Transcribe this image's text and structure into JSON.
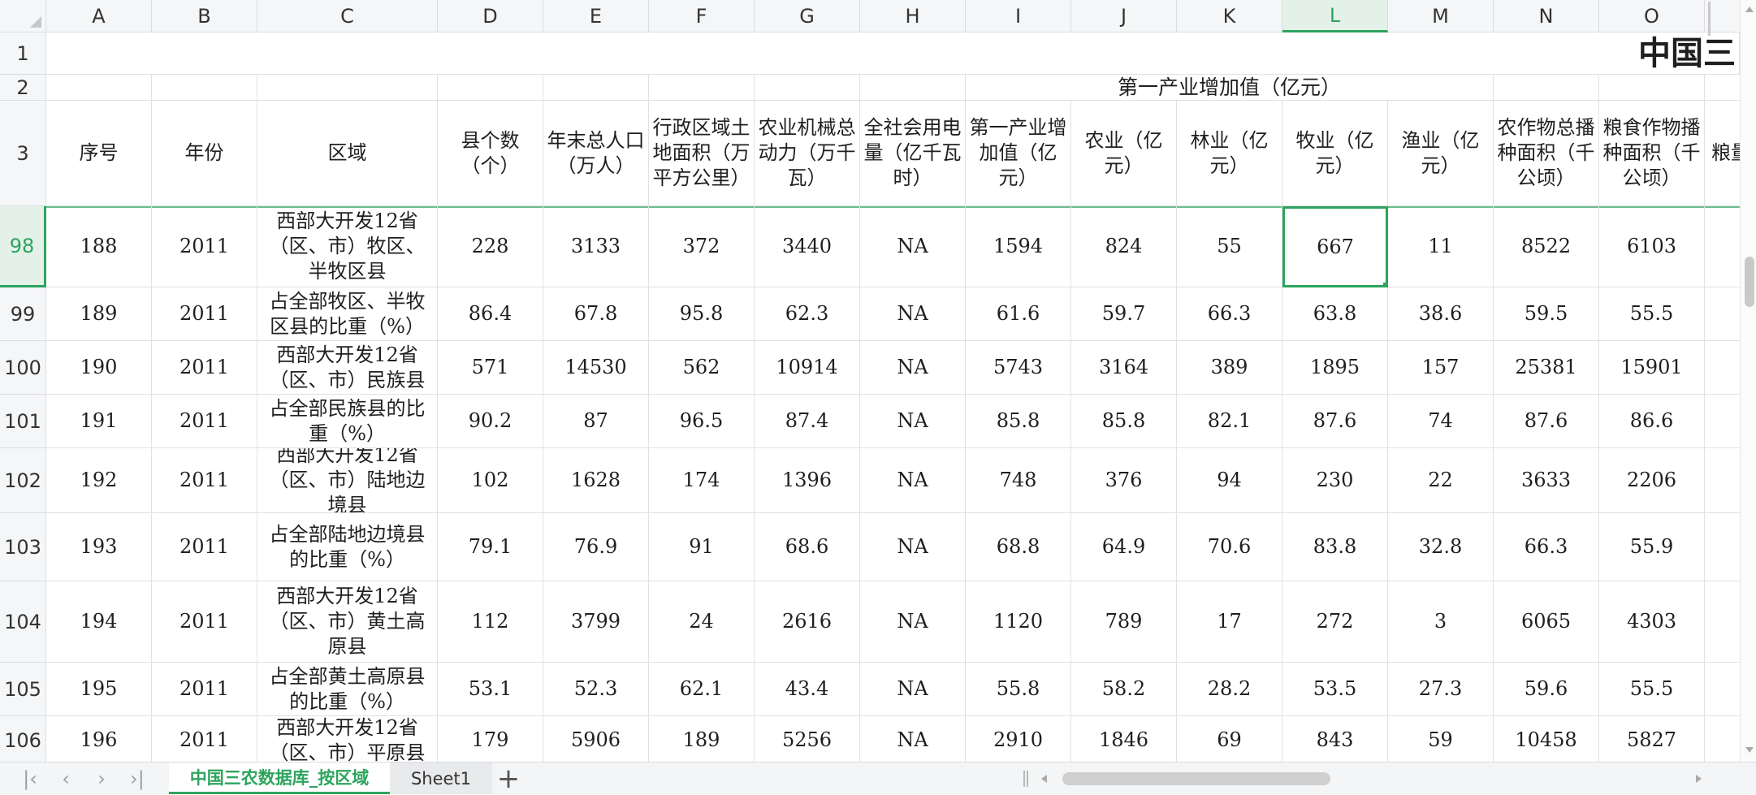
{
  "columns": [
    "A",
    "B",
    "C",
    "D",
    "E",
    "F",
    "G",
    "H",
    "I",
    "J",
    "K",
    "L",
    "M",
    "N",
    "O"
  ],
  "selected_column": "L",
  "selected_row": "98",
  "row1": {
    "row_number": "1",
    "title": "中国三"
  },
  "row2": {
    "row_number": "2",
    "group_header": "第一产业增加值（亿元）"
  },
  "row3": {
    "row_number": "3",
    "headers": [
      "序号",
      "年份",
      "区域",
      "县个数（个）",
      "年末总人口（万人）",
      "行政区域土地面积（万平方公里）",
      "农业机械总动力（万千瓦）",
      "全社会用电量（亿千瓦时）",
      "第一产业增加值（亿元）",
      "农业（亿元）",
      "林业（亿元）",
      "牧业（亿元）",
      "渔业（亿元）",
      "农作物总播种面积（千公顷）",
      "粮食作物播种面积（千公顷）",
      "粮量"
    ]
  },
  "rows": [
    {
      "row_number": "98",
      "cells": [
        "188",
        "2011",
        "西部大开发12省（区、市）牧区、半牧区县",
        "228",
        "3133",
        "372",
        "3440",
        "NA",
        "1594",
        "824",
        "55",
        "667",
        "11",
        "8522",
        "6103"
      ]
    },
    {
      "row_number": "99",
      "cells": [
        "189",
        "2011",
        "占全部牧区、半牧区县的比重（%）",
        "86.4",
        "67.8",
        "95.8",
        "62.3",
        "NA",
        "61.6",
        "59.7",
        "66.3",
        "63.8",
        "38.6",
        "59.5",
        "55.5"
      ]
    },
    {
      "row_number": "100",
      "cells": [
        "190",
        "2011",
        "西部大开发12省（区、市）民族县",
        "571",
        "14530",
        "562",
        "10914",
        "NA",
        "5743",
        "3164",
        "389",
        "1895",
        "157",
        "25381",
        "15901"
      ]
    },
    {
      "row_number": "101",
      "cells": [
        "191",
        "2011",
        "占全部民族县的比重（%）",
        "90.2",
        "87",
        "96.5",
        "87.4",
        "NA",
        "85.8",
        "85.8",
        "82.1",
        "87.6",
        "74",
        "87.6",
        "86.6"
      ]
    },
    {
      "row_number": "102",
      "cells": [
        "192",
        "2011",
        "西部大开发12省（区、市）陆地边境县",
        "102",
        "1628",
        "174",
        "1396",
        "NA",
        "748",
        "376",
        "94",
        "230",
        "22",
        "3633",
        "2206"
      ]
    },
    {
      "row_number": "103",
      "cells": [
        "193",
        "2011",
        "占全部陆地边境县的比重（%）",
        "79.1",
        "76.9",
        "91",
        "68.6",
        "NA",
        "68.8",
        "64.9",
        "70.6",
        "83.8",
        "32.8",
        "66.3",
        "55.9"
      ]
    },
    {
      "row_number": "104",
      "cells": [
        "194",
        "2011",
        "西部大开发12省（区、市）黄土高原县",
        "112",
        "3799",
        "24",
        "2616",
        "NA",
        "1120",
        "789",
        "17",
        "272",
        "3",
        "6065",
        "4303"
      ]
    },
    {
      "row_number": "105",
      "cells": [
        "195",
        "2011",
        "占全部黄土高原县的比重（%）",
        "53.1",
        "52.3",
        "62.1",
        "43.4",
        "NA",
        "55.8",
        "58.2",
        "28.2",
        "53.5",
        "27.3",
        "59.6",
        "55.5"
      ]
    },
    {
      "row_number": "106",
      "cells": [
        "196",
        "2011",
        "西部大开发12省（区、市）平原县",
        "179",
        "5906",
        "189",
        "5256",
        "NA",
        "2910",
        "1846",
        "69",
        "843",
        "59",
        "10458",
        "5827"
      ]
    }
  ],
  "tabs": [
    {
      "label": "中国三农数据库_按区域",
      "active": true
    },
    {
      "label": "Sheet1",
      "active": false
    }
  ],
  "icons": {
    "first": "first-sheet-icon",
    "prev": "prev-sheet-icon",
    "next": "next-sheet-icon",
    "last": "last-sheet-icon",
    "add": "add-sheet-icon"
  },
  "colors": {
    "accent": "#2da45d",
    "grid": "#dfe1e5",
    "header_bg": "#f5f6f7"
  }
}
